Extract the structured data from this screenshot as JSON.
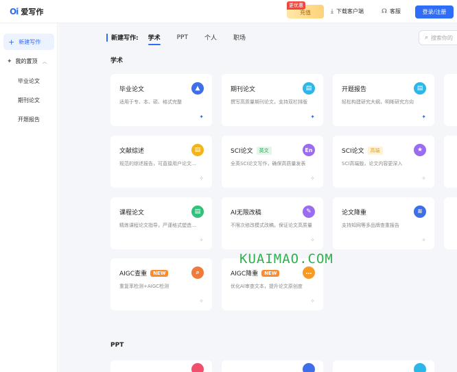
{
  "header": {
    "logo_mark": "Oi",
    "logo_text": "爱写作",
    "recharge_badge": "更优惠",
    "recharge_label": "充值",
    "download_label": "下载客户端",
    "service_label": "客服",
    "login_label": "登录/注册"
  },
  "sidebar": {
    "new_writing": "新建写作",
    "pinned": "我的置顶",
    "sub_items": [
      "毕业论文",
      "期刊论文",
      "开题报告"
    ]
  },
  "tabs": {
    "title": "新建写作:",
    "items": [
      "学术",
      "PPT",
      "个人",
      "职场"
    ]
  },
  "search": {
    "placeholder": "搜索你的"
  },
  "sections": {
    "academic": "学术",
    "ppt": "PPT"
  },
  "cards": [
    {
      "title": "毕业论文",
      "desc": "适用于专、本、硕、格式完整",
      "icon": "graduation-cap-icon",
      "color": "#3f6fe8"
    },
    {
      "title": "期刊论文",
      "desc": "撰写高质量期刊论文，支持双栏排版",
      "icon": "document-icon",
      "color": "#2fb6e8"
    },
    {
      "title": "开题报告",
      "desc": "轻松构建研究大纲，明晰研究方向",
      "icon": "document-icon",
      "color": "#2fb6e8"
    },
    {
      "title": "文献综述",
      "desc": "规范的综述报告，可直接用户论文...",
      "icon": "document-icon",
      "color": "#f2b419"
    },
    {
      "title": "SCI论文",
      "tag": "英文",
      "desc": "全英SCI论文写作，确保高质量发表",
      "icon": "en-icon",
      "color": "#9b6bf0"
    },
    {
      "title": "SCI论文",
      "tag": "高端",
      "desc": "SCI高端版，论文内容更深入",
      "icon": "star-icon",
      "color": "#9b6bf0"
    },
    {
      "title": "课程论文",
      "desc": "精炼课程论文指导，严谨格式塑造...",
      "icon": "document-icon",
      "color": "#33c07b"
    },
    {
      "title": "AI无限改稿",
      "desc": "不限次修改模式改稿，保证论文高质量",
      "icon": "pen-icon",
      "color": "#9b6bf0"
    },
    {
      "title": "论文降重",
      "desc": "支持知网等多品牌查重报告",
      "icon": "layers-icon",
      "color": "#3f6fe8"
    },
    {
      "title": "AIGC查重",
      "tag": "NEW",
      "desc": "重复率检测+AIGC检测",
      "icon": "search-icon",
      "color": "#f07a3a"
    },
    {
      "title": "AIGC降重",
      "tag": "NEW",
      "desc": "优化AI审查文本，提升论文原创度",
      "icon": "chat-icon",
      "color": "#f79a23"
    }
  ],
  "watermark": "KUAIMAO.COM"
}
